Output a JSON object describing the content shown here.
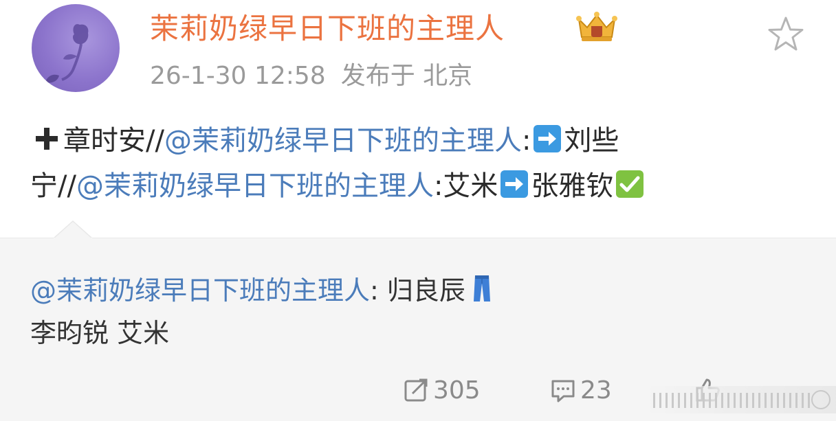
{
  "post": {
    "username": "茉莉奶绿早日下班的主理人",
    "timestamp": "26-1-30 12:58",
    "location": "发布于 北京"
  },
  "content": {
    "line1": {
      "prefix": "章时安//",
      "mention": "@茉莉奶绿早日下班的主理人",
      "after_mention": ":",
      "tail": "刘些"
    },
    "line2": {
      "prefix": "宁//",
      "mention": "@茉莉奶绿早日下班的主理人",
      "after_mention": ":艾米",
      "tail": "张雅钦"
    }
  },
  "quote": {
    "mention": "@茉莉奶绿早日下班的主理人",
    "after_mention": ": 归良辰",
    "line2": "李昀锐 艾米"
  },
  "actions": {
    "repost_count": "305",
    "comment_count": "23",
    "like_count": ""
  },
  "icons": [
    "plus-emoji-icon",
    "right-arrow-emoji-icon",
    "check-mark-emoji-icon",
    "jeans-emoji-icon",
    "crown-badge-icon",
    "star-icon",
    "repost-icon",
    "comment-icon",
    "like-icon"
  ],
  "colors": {
    "username": "#eb7340",
    "mention": "#4b7cba",
    "meta": "#9a9a9a",
    "quote_bg": "#f5f5f5"
  }
}
